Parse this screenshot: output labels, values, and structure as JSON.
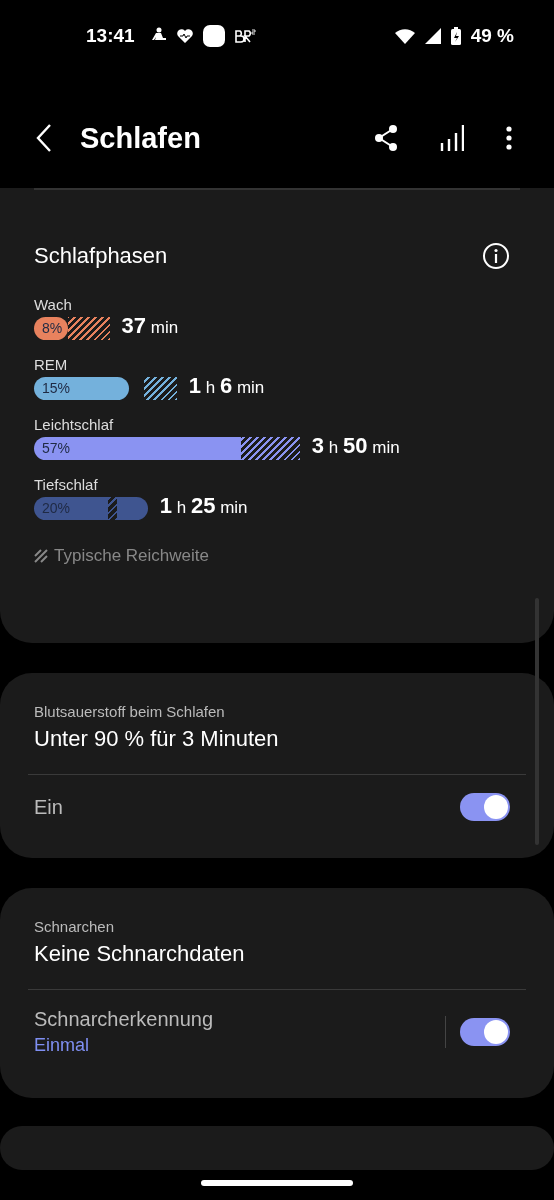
{
  "status_bar": {
    "time": "13:41",
    "battery": "49 %"
  },
  "header": {
    "title": "Schlafen"
  },
  "sleep_phases": {
    "title": "Schlafphasen",
    "phases": [
      {
        "name": "Wach",
        "percent": "8%",
        "duration": "**37** min",
        "color": "#e8825e"
      },
      {
        "name": "REM",
        "percent": "15%",
        "duration": "**1** h **6** min",
        "color": "#74b1dc"
      },
      {
        "name": "Leichtschlaf",
        "percent": "57%",
        "duration": "**3** h **50** min",
        "color": "#8a93f2"
      },
      {
        "name": "Tiefschlaf",
        "percent": "20%",
        "duration": "**1** h **25** min",
        "color": "#3f5590"
      }
    ],
    "legend": "Typische Reichweite"
  },
  "blood_oxygen": {
    "label": "Blutsauerstoff beim Schlafen",
    "value": "Unter 90 % für 3 Minuten",
    "setting": {
      "label": "Ein",
      "on": true
    }
  },
  "snoring": {
    "label": "Schnarchen",
    "value": "Keine Schnarchdaten",
    "setting": {
      "label": "Schnarcherkennung",
      "sublabel": "Einmal",
      "on": true
    }
  }
}
